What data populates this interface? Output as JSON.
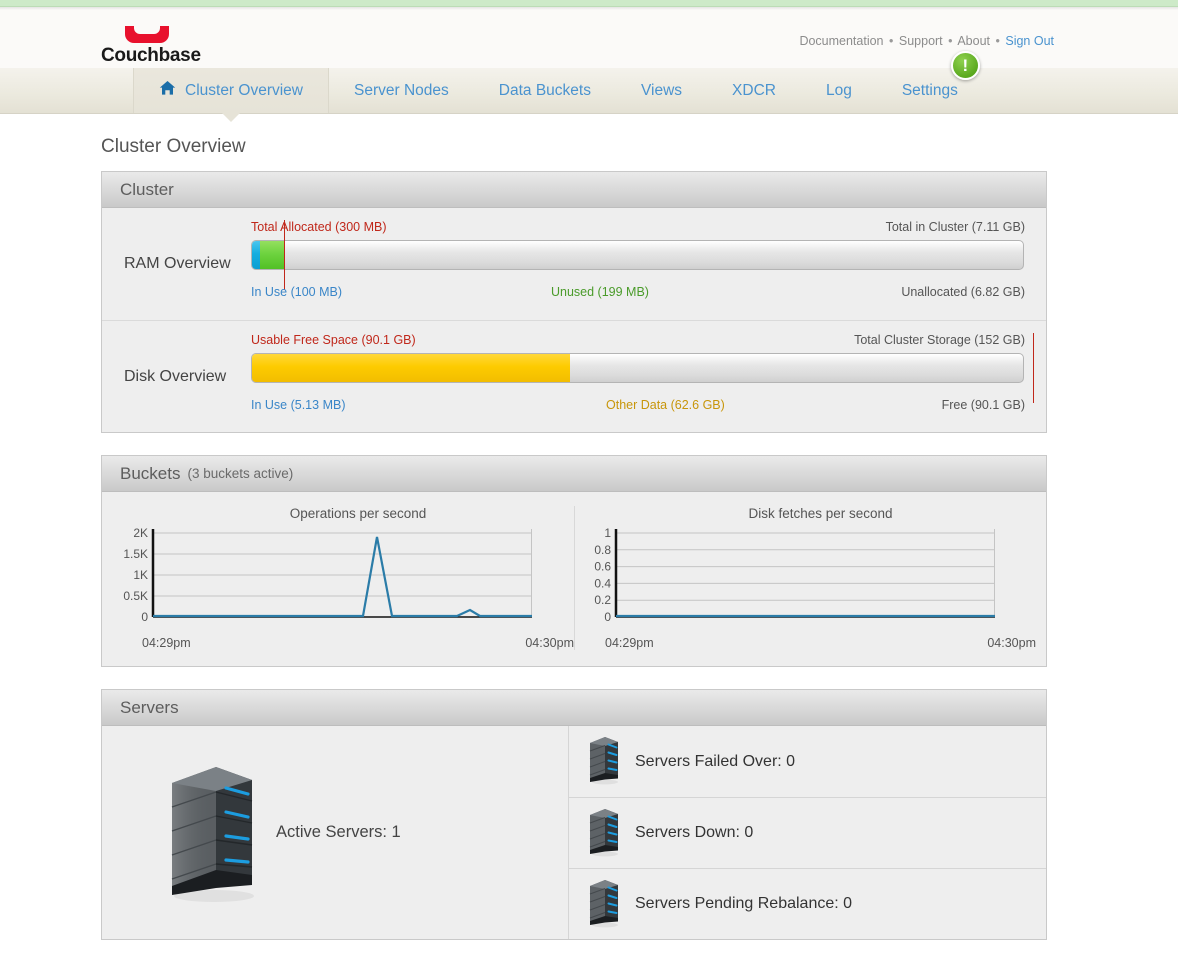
{
  "header": {
    "logo_text": "Couchbase",
    "links": [
      {
        "label": "Documentation",
        "kind": "plain"
      },
      {
        "label": "Support",
        "kind": "plain"
      },
      {
        "label": "About",
        "kind": "plain"
      },
      {
        "label": "Sign Out",
        "kind": "link"
      }
    ],
    "separator": "•"
  },
  "nav": {
    "tabs": [
      {
        "label": "Cluster Overview",
        "active": true,
        "icon": "home-icon"
      },
      {
        "label": "Server Nodes",
        "active": false
      },
      {
        "label": "Data Buckets",
        "active": false
      },
      {
        "label": "Views",
        "active": false
      },
      {
        "label": "XDCR",
        "active": false
      },
      {
        "label": "Log",
        "active": false
      },
      {
        "label": "Settings",
        "active": false,
        "badge": "!"
      }
    ],
    "badge_color": "#6cc024"
  },
  "page": {
    "title": "Cluster Overview"
  },
  "cluster_panel": {
    "title": "Cluster",
    "ram": {
      "label": "RAM Overview",
      "top_left": "Total Allocated (300 MB)",
      "top_right": "Total in Cluster (7.11 GB)",
      "bottom_left": "In Use (100 MB)",
      "bottom_center": "Unused (199 MB)",
      "bottom_right": "Unallocated (6.82 GB)",
      "in_use_pct": 1.1,
      "unused_pct": 3.2,
      "allocated_pct": 4.3,
      "colors": {
        "in_use": "#16aee0",
        "unused": "#6ed33f",
        "marker": "#c0271a"
      }
    },
    "disk": {
      "label": "Disk Overview",
      "top_left": "Usable Free Space (90.1 GB)",
      "top_right": "Total Cluster Storage (152 GB)",
      "bottom_left": "In Use (5.13 MB)",
      "bottom_center": "Other Data (62.6 GB)",
      "bottom_right": "Free (90.1 GB)",
      "in_use_pct": 0.01,
      "other_data_pct": 41.2,
      "marker_pct": 100,
      "colors": {
        "other_data": "#fdcb00",
        "marker": "#c0271a"
      }
    }
  },
  "buckets_panel": {
    "title": "Buckets",
    "subtitle": "(3 buckets active)"
  },
  "servers_panel": {
    "title": "Servers",
    "active_label": "Active Servers: 1",
    "stats": [
      {
        "label": "Servers Failed Over: 0",
        "icon": "server-icon"
      },
      {
        "label": "Servers Down: 0",
        "icon": "server-icon"
      },
      {
        "label": "Servers Pending Rebalance: 0",
        "icon": "server-icon"
      }
    ]
  },
  "chart_data": [
    {
      "type": "line",
      "title": "Operations per second",
      "xlabel": "",
      "ylabel": "",
      "ylim": [
        0,
        2000
      ],
      "yticks": [
        0,
        500,
        1000,
        1500,
        2000
      ],
      "ytick_labels": [
        "0",
        "0.5K",
        "1K",
        "1.5K",
        "2K"
      ],
      "xlim_labels": [
        "04:29pm",
        "04:30pm"
      ],
      "grid": true,
      "legend": "none",
      "line_color": "#2b7ca8",
      "x": [
        0,
        10,
        20,
        30,
        40,
        50,
        55,
        57,
        59,
        61,
        63,
        65,
        70,
        75,
        80,
        82,
        84,
        86,
        90,
        95,
        100
      ],
      "values": [
        0,
        0,
        0,
        0,
        0,
        0,
        0,
        0,
        1850,
        900,
        0,
        0,
        0,
        0,
        40,
        130,
        60,
        0,
        0,
        0,
        0
      ]
    },
    {
      "type": "line",
      "title": "Disk fetches per second",
      "xlabel": "",
      "ylabel": "",
      "ylim": [
        0,
        1
      ],
      "yticks": [
        0,
        0.2,
        0.4,
        0.6,
        0.8,
        1
      ],
      "ytick_labels": [
        "0",
        "0.2",
        "0.4",
        "0.6",
        "0.8",
        "1"
      ],
      "xlim_labels": [
        "04:29pm",
        "04:30pm"
      ],
      "grid": true,
      "legend": "none",
      "line_color": "#2b7ca8",
      "x": [
        0,
        20,
        40,
        60,
        80,
        100
      ],
      "values": [
        0,
        0,
        0,
        0,
        0,
        0
      ]
    }
  ]
}
